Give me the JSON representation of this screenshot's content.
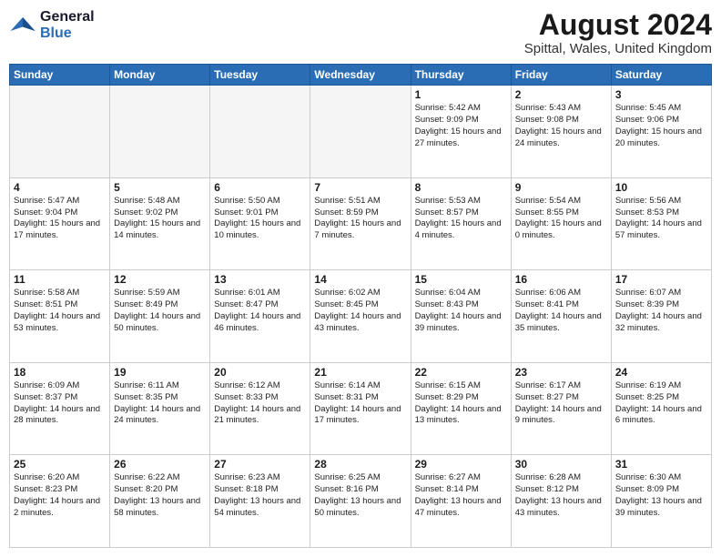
{
  "logo": {
    "line1": "General",
    "line2": "Blue"
  },
  "header": {
    "month_year": "August 2024",
    "location": "Spittal, Wales, United Kingdom"
  },
  "days_of_week": [
    "Sunday",
    "Monday",
    "Tuesday",
    "Wednesday",
    "Thursday",
    "Friday",
    "Saturday"
  ],
  "weeks": [
    [
      {
        "day": "",
        "info": ""
      },
      {
        "day": "",
        "info": ""
      },
      {
        "day": "",
        "info": ""
      },
      {
        "day": "",
        "info": ""
      },
      {
        "day": "1",
        "info": "Sunrise: 5:42 AM\nSunset: 9:09 PM\nDaylight: 15 hours\nand 27 minutes."
      },
      {
        "day": "2",
        "info": "Sunrise: 5:43 AM\nSunset: 9:08 PM\nDaylight: 15 hours\nand 24 minutes."
      },
      {
        "day": "3",
        "info": "Sunrise: 5:45 AM\nSunset: 9:06 PM\nDaylight: 15 hours\nand 20 minutes."
      }
    ],
    [
      {
        "day": "4",
        "info": "Sunrise: 5:47 AM\nSunset: 9:04 PM\nDaylight: 15 hours\nand 17 minutes."
      },
      {
        "day": "5",
        "info": "Sunrise: 5:48 AM\nSunset: 9:02 PM\nDaylight: 15 hours\nand 14 minutes."
      },
      {
        "day": "6",
        "info": "Sunrise: 5:50 AM\nSunset: 9:01 PM\nDaylight: 15 hours\nand 10 minutes."
      },
      {
        "day": "7",
        "info": "Sunrise: 5:51 AM\nSunset: 8:59 PM\nDaylight: 15 hours\nand 7 minutes."
      },
      {
        "day": "8",
        "info": "Sunrise: 5:53 AM\nSunset: 8:57 PM\nDaylight: 15 hours\nand 4 minutes."
      },
      {
        "day": "9",
        "info": "Sunrise: 5:54 AM\nSunset: 8:55 PM\nDaylight: 15 hours\nand 0 minutes."
      },
      {
        "day": "10",
        "info": "Sunrise: 5:56 AM\nSunset: 8:53 PM\nDaylight: 14 hours\nand 57 minutes."
      }
    ],
    [
      {
        "day": "11",
        "info": "Sunrise: 5:58 AM\nSunset: 8:51 PM\nDaylight: 14 hours\nand 53 minutes."
      },
      {
        "day": "12",
        "info": "Sunrise: 5:59 AM\nSunset: 8:49 PM\nDaylight: 14 hours\nand 50 minutes."
      },
      {
        "day": "13",
        "info": "Sunrise: 6:01 AM\nSunset: 8:47 PM\nDaylight: 14 hours\nand 46 minutes."
      },
      {
        "day": "14",
        "info": "Sunrise: 6:02 AM\nSunset: 8:45 PM\nDaylight: 14 hours\nand 43 minutes."
      },
      {
        "day": "15",
        "info": "Sunrise: 6:04 AM\nSunset: 8:43 PM\nDaylight: 14 hours\nand 39 minutes."
      },
      {
        "day": "16",
        "info": "Sunrise: 6:06 AM\nSunset: 8:41 PM\nDaylight: 14 hours\nand 35 minutes."
      },
      {
        "day": "17",
        "info": "Sunrise: 6:07 AM\nSunset: 8:39 PM\nDaylight: 14 hours\nand 32 minutes."
      }
    ],
    [
      {
        "day": "18",
        "info": "Sunrise: 6:09 AM\nSunset: 8:37 PM\nDaylight: 14 hours\nand 28 minutes."
      },
      {
        "day": "19",
        "info": "Sunrise: 6:11 AM\nSunset: 8:35 PM\nDaylight: 14 hours\nand 24 minutes."
      },
      {
        "day": "20",
        "info": "Sunrise: 6:12 AM\nSunset: 8:33 PM\nDaylight: 14 hours\nand 21 minutes."
      },
      {
        "day": "21",
        "info": "Sunrise: 6:14 AM\nSunset: 8:31 PM\nDaylight: 14 hours\nand 17 minutes."
      },
      {
        "day": "22",
        "info": "Sunrise: 6:15 AM\nSunset: 8:29 PM\nDaylight: 14 hours\nand 13 minutes."
      },
      {
        "day": "23",
        "info": "Sunrise: 6:17 AM\nSunset: 8:27 PM\nDaylight: 14 hours\nand 9 minutes."
      },
      {
        "day": "24",
        "info": "Sunrise: 6:19 AM\nSunset: 8:25 PM\nDaylight: 14 hours\nand 6 minutes."
      }
    ],
    [
      {
        "day": "25",
        "info": "Sunrise: 6:20 AM\nSunset: 8:23 PM\nDaylight: 14 hours\nand 2 minutes."
      },
      {
        "day": "26",
        "info": "Sunrise: 6:22 AM\nSunset: 8:20 PM\nDaylight: 13 hours\nand 58 minutes."
      },
      {
        "day": "27",
        "info": "Sunrise: 6:23 AM\nSunset: 8:18 PM\nDaylight: 13 hours\nand 54 minutes."
      },
      {
        "day": "28",
        "info": "Sunrise: 6:25 AM\nSunset: 8:16 PM\nDaylight: 13 hours\nand 50 minutes."
      },
      {
        "day": "29",
        "info": "Sunrise: 6:27 AM\nSunset: 8:14 PM\nDaylight: 13 hours\nand 47 minutes."
      },
      {
        "day": "30",
        "info": "Sunrise: 6:28 AM\nSunset: 8:12 PM\nDaylight: 13 hours\nand 43 minutes."
      },
      {
        "day": "31",
        "info": "Sunrise: 6:30 AM\nSunset: 8:09 PM\nDaylight: 13 hours\nand 39 minutes."
      }
    ]
  ]
}
